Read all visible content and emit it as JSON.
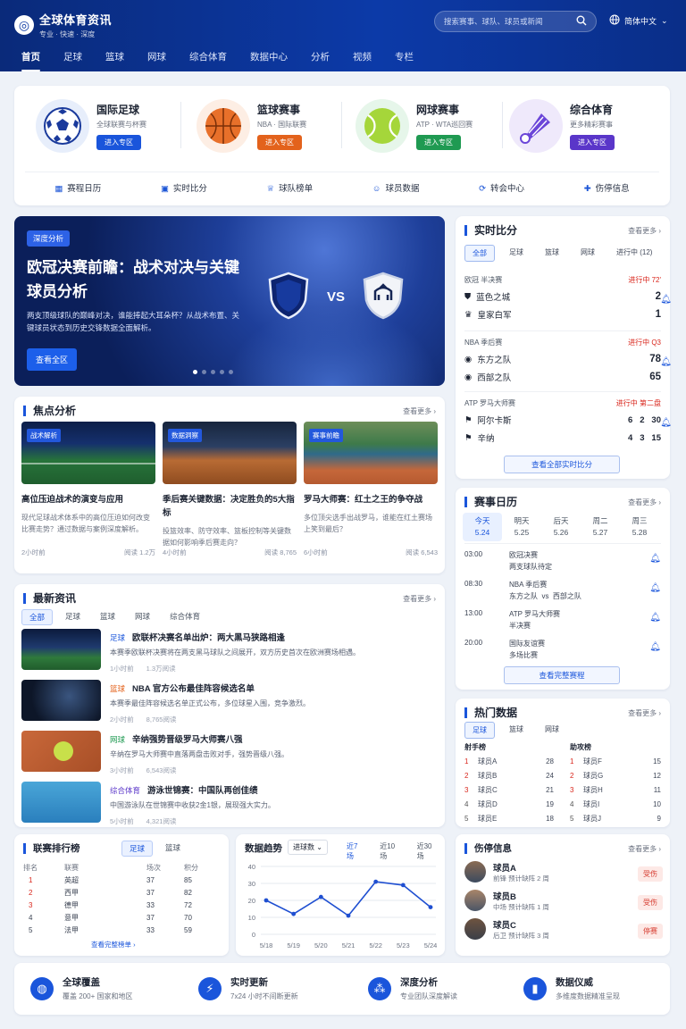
{
  "brand": {
    "title": "全球体育资讯",
    "subtitle": "专业 · 快速 · 深度"
  },
  "search": {
    "placeholder": "搜索赛事、球队、球员或新闻"
  },
  "lang": "简体中文",
  "nav": [
    "首页",
    "足球",
    "篮球",
    "网球",
    "综合体育",
    "数据中心",
    "分析",
    "视频",
    "专栏"
  ],
  "categories": [
    {
      "name": "国际足球",
      "desc": "全球联赛与杯赛",
      "btn": "进入专区",
      "color": "#1a55db"
    },
    {
      "name": "篮球赛事",
      "desc": "NBA · 国际联赛",
      "btn": "进入专区",
      "color": "#e3621c"
    },
    {
      "name": "网球赛事",
      "desc": "ATP · WTA巡回赛",
      "btn": "进入专区",
      "color": "#1f9a52"
    },
    {
      "name": "综合体育",
      "desc": "更多精彩赛事",
      "btn": "进入专区",
      "color": "#5a36c9"
    }
  ],
  "tools": [
    "赛程日历",
    "实时比分",
    "球队榜单",
    "球员数据",
    "转会中心",
    "伤停信息"
  ],
  "hero": {
    "tag": "深度分析",
    "title": "欧冠决赛前瞻：战术对决与关键球员分析",
    "desc": "两支顶级球队的巅峰对决，谁能捧起大耳朵杯？从战术布置、关键球员状态到历史交锋数据全面解析。",
    "btn": "查看全区",
    "vs": "VS"
  },
  "focus": {
    "title": "焦点分析",
    "more": "查看更多",
    "items": [
      {
        "tag": "战术解析",
        "title": "高位压迫战术的演变与应用",
        "desc": "现代足球战术体系中的高位压迫如何改变比赛走势？通过数据与案例深度解析。",
        "time": "2小时前",
        "reads": "阅读 1.2万"
      },
      {
        "tag": "数据洞察",
        "title": "季后赛关键数据：决定胜负的5大指标",
        "desc": "投篮效率、防守效率、篮板控制等关键数据如何影响季后赛走向？",
        "time": "4小时前",
        "reads": "阅读 8,765"
      },
      {
        "tag": "赛事前瞻",
        "title": "罗马大师赛：红土之王的争夺战",
        "desc": "多位顶尖选手出战罗马，谁能在红土赛场上笑到最后？",
        "time": "6小时前",
        "reads": "阅读 6,543"
      }
    ]
  },
  "news": {
    "title": "最新资讯",
    "more": "查看更多",
    "tabs": [
      "全部",
      "足球",
      "篮球",
      "网球",
      "综合体育"
    ],
    "items": [
      {
        "cat": "足球",
        "title": "欧联杯决赛名单出炉：两大黑马狭路相逢",
        "desc": "本赛季欧联杯决赛将在两支黑马球队之间展开，双方历史首次在欧洲赛场相遇。",
        "time": "1小时前",
        "reads": "1.3万阅读",
        "catColor": "#1a55db"
      },
      {
        "cat": "篮球",
        "title": "NBA 官方公布最佳阵容候选名单",
        "desc": "本赛季最佳阵容候选名单正式公布，多位球星入围，竞争激烈。",
        "time": "2小时前",
        "reads": "8,765阅读",
        "catColor": "#e3621c"
      },
      {
        "cat": "网球",
        "title": "辛纳强势晋级罗马大师赛八强",
        "desc": "辛纳在罗马大师赛中直落两盘击败对手，强势晋级八强。",
        "time": "3小时前",
        "reads": "6,543阅读",
        "catColor": "#1f9a52"
      },
      {
        "cat": "综合体育",
        "title": "游泳世锦赛：中国队再创佳绩",
        "desc": "中国游泳队在世锦赛中收获2金1银，展现强大实力。",
        "time": "5小时前",
        "reads": "4,321阅读",
        "catColor": "#5a36c9"
      }
    ]
  },
  "live": {
    "title": "实时比分",
    "more": "查看更多",
    "tabs": [
      "全部",
      "足球",
      "篮球",
      "网球",
      "进行中 (12)"
    ],
    "btn": "查看全部实时比分",
    "matches": [
      {
        "league": "欧冠 半决赛",
        "status": "进行中 72'",
        "teams": [
          {
            "name": "蓝色之城",
            "score": "2"
          },
          {
            "name": "皇家白军",
            "score": "1"
          }
        ]
      },
      {
        "league": "NBA 季后赛",
        "status": "进行中 Q3",
        "teams": [
          {
            "name": "东方之队",
            "score": "78"
          },
          {
            "name": "西部之队",
            "score": "65"
          }
        ]
      },
      {
        "league": "ATP 罗马大师赛",
        "status": "进行中 第二盘",
        "teams": [
          {
            "name": "阿尔卡斯",
            "score": "6   2   30"
          },
          {
            "name": "辛纳",
            "score": "4   3   15"
          }
        ]
      }
    ]
  },
  "schedule": {
    "title": "赛事日历",
    "more": "查看更多",
    "days": [
      {
        "d": "今天",
        "date": "5.24"
      },
      {
        "d": "明天",
        "date": "5.25"
      },
      {
        "d": "后天",
        "date": "5.26"
      },
      {
        "d": "周二",
        "date": "5.27"
      },
      {
        "d": "周三",
        "date": "5.28"
      }
    ],
    "rows": [
      {
        "t": "03:00",
        "l1": "欧冠决赛",
        "l2": "两支球队待定"
      },
      {
        "t": "08:30",
        "l1": "NBA 季后赛",
        "l2": "东方之队  vs  西部之队"
      },
      {
        "t": "13:00",
        "l1": "ATP 罗马大师赛",
        "l2": "半决赛"
      },
      {
        "t": "20:00",
        "l1": "国际友谊赛",
        "l2": "多场比赛"
      }
    ],
    "btn": "查看完整赛程"
  },
  "hot": {
    "title": "热门数据",
    "more": "查看更多",
    "tabs": [
      "足球",
      "篮球",
      "网球"
    ],
    "scorers": {
      "title": "射手榜",
      "rows": [
        [
          "1",
          "球员A",
          "28"
        ],
        [
          "2",
          "球员B",
          "24"
        ],
        [
          "3",
          "球员C",
          "21"
        ],
        [
          "4",
          "球员D",
          "19"
        ],
        [
          "5",
          "球员E",
          "18"
        ]
      ]
    },
    "assists": {
      "title": "助攻榜",
      "rows": [
        [
          "1",
          "球员F",
          "15"
        ],
        [
          "2",
          "球员G",
          "12"
        ],
        [
          "3",
          "球员H",
          "11"
        ],
        [
          "4",
          "球员I",
          "10"
        ],
        [
          "5",
          "球员J",
          "9"
        ]
      ]
    }
  },
  "rank": {
    "title": "联赛排行榜",
    "tabs": [
      "足球",
      "篮球"
    ],
    "headers": [
      "排名",
      "联赛",
      "场次",
      "积分"
    ],
    "rows": [
      [
        "1",
        "英超",
        "37",
        "85"
      ],
      [
        "2",
        "西甲",
        "37",
        "82"
      ],
      [
        "3",
        "德甲",
        "33",
        "72"
      ],
      [
        "4",
        "意甲",
        "37",
        "70"
      ],
      [
        "5",
        "法甲",
        "33",
        "59"
      ]
    ],
    "link": "查看完整榜单"
  },
  "trend": {
    "title": "数据趋势",
    "select": "进球数",
    "tabs": [
      "近7场",
      "近10场",
      "近30场"
    ]
  },
  "chart_data": {
    "type": "line",
    "x": [
      "5/18",
      "5/19",
      "5/20",
      "5/21",
      "5/22",
      "5/23",
      "5/24"
    ],
    "values": [
      20,
      12,
      22,
      11,
      31,
      29,
      16
    ],
    "ylim": [
      0,
      40
    ],
    "yticks": [
      0,
      10,
      20,
      30,
      40
    ],
    "color": "#1f4fd1"
  },
  "injury": {
    "title": "伤停信息",
    "more": "查看更多",
    "rows": [
      {
        "name": "球员A",
        "pos": "前锋",
        "note": "预计缺阵 2 周",
        "badge": "受伤"
      },
      {
        "name": "球员B",
        "pos": "中场",
        "note": "预计缺阵 1 周",
        "badge": "受伤"
      },
      {
        "name": "球员C",
        "pos": "后卫",
        "note": "预计缺阵 3 周",
        "badge": "停赛"
      }
    ]
  },
  "footer": [
    {
      "title": "全球覆盖",
      "desc": "覆盖 200+ 国家和地区"
    },
    {
      "title": "实时更新",
      "desc": "7x24 小时不间断更新"
    },
    {
      "title": "深度分析",
      "desc": "专业团队深度解读"
    },
    {
      "title": "数据仪威",
      "desc": "多维度数据精准呈现"
    }
  ]
}
